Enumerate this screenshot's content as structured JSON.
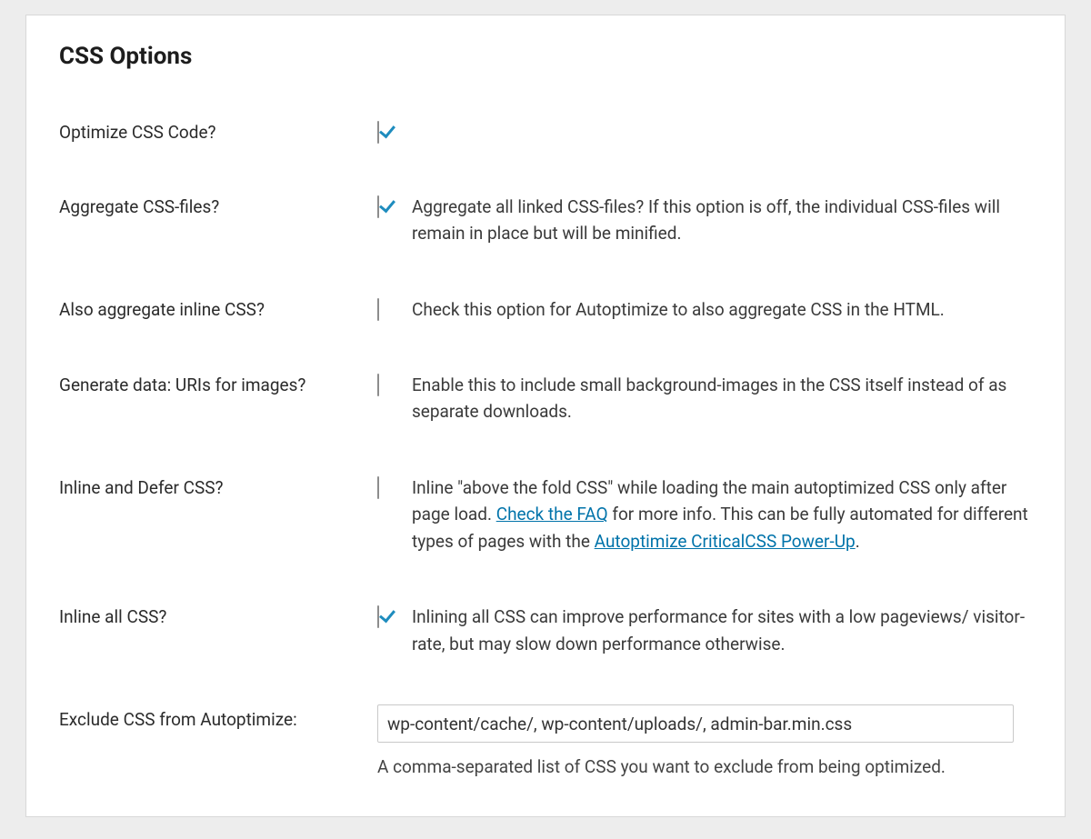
{
  "section_title": "CSS Options",
  "link_color": "#0073aa",
  "rows": {
    "optimize": {
      "label": "Optimize CSS Code?",
      "checked": true,
      "desc": ""
    },
    "aggregate": {
      "label": "Aggregate CSS-files?",
      "checked": true,
      "desc": "Aggregate all linked CSS-files? If this option is off, the individual CSS-files will remain in place but will be minified."
    },
    "aggregate_inline": {
      "label": "Also aggregate inline CSS?",
      "checked": false,
      "desc": "Check this option for Autoptimize to also aggregate CSS in the HTML."
    },
    "datauri": {
      "label": "Generate data: URIs for images?",
      "checked": false,
      "desc": "Enable this to include small background-images in the CSS itself instead of as separate downloads."
    },
    "inline_defer": {
      "label": "Inline and Defer CSS?",
      "checked": false,
      "desc_pre": "Inline \"above the fold CSS\" while loading the main autoptimized CSS only after page load. ",
      "link1": "Check the FAQ",
      "desc_mid": " for more info. This can be fully automated for different types of pages with the ",
      "link2": "Autoptimize CriticalCSS Power-Up",
      "desc_post": "."
    },
    "inline_all": {
      "label": "Inline all CSS?",
      "checked": true,
      "desc": "Inlining all CSS can improve performance for sites with a low pageviews/ visitor-rate, but may slow down performance otherwise."
    },
    "exclude": {
      "label": "Exclude CSS from Autoptimize:",
      "value": "wp-content/cache/, wp-content/uploads/, admin-bar.min.css",
      "helper": "A comma-separated list of CSS you want to exclude from being optimized."
    }
  }
}
